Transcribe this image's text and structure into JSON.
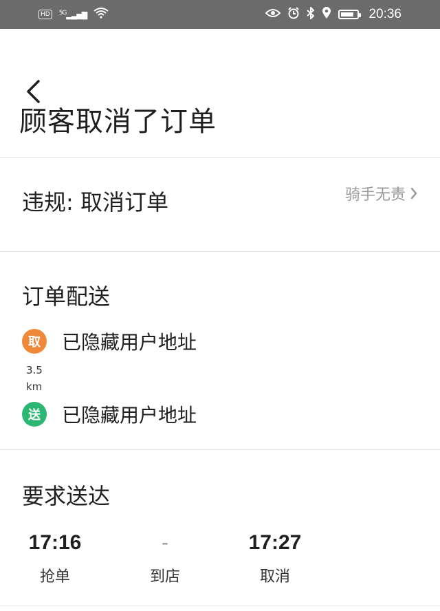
{
  "status_bar": {
    "hd": "HD",
    "network": "5G",
    "time": "20:36"
  },
  "header": {
    "title": "顾客取消了订单"
  },
  "violation": {
    "text": "违规: 取消订单",
    "link_label": "骑手无责"
  },
  "delivery": {
    "title": "订单配送",
    "pickup": {
      "badge": "取",
      "address": "已隐藏用户地址",
      "color": "#f0883a"
    },
    "distance_value": "3.5",
    "distance_unit": "km",
    "dropoff": {
      "badge": "送",
      "address": "已隐藏用户地址",
      "color": "#2bb673"
    }
  },
  "deadline": {
    "title": "要求送达",
    "columns": [
      {
        "value": "17:16",
        "label": "抢单"
      },
      {
        "value": "-",
        "label": "到店"
      },
      {
        "value": "17:27",
        "label": "取消"
      }
    ]
  }
}
